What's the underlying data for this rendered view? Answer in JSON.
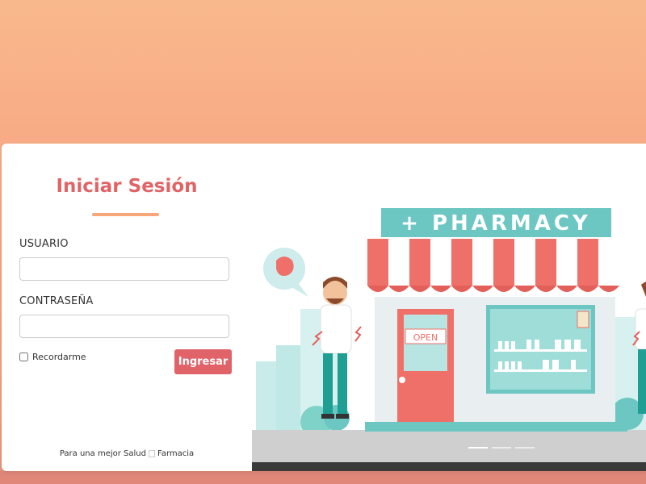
{
  "login": {
    "title": "Iniciar Sesión",
    "username_label": "USUARIO",
    "username_value": "",
    "password_label": "CONTRASEÑA",
    "password_value": "",
    "remember_label": "Recordarme",
    "submit_label": "Ingresar"
  },
  "footer": {
    "text_before": "Para una mejor Salud",
    "text_after": "Farmacia"
  },
  "illustration": {
    "sign_text": "+ PHARMACY",
    "door_sign": "OPEN",
    "carousel": {
      "slides": 3,
      "active": 1
    }
  },
  "colors": {
    "accent": "#e0636a",
    "title": "#e06466",
    "underline": "#f7a779",
    "background_top": "#f9b88c",
    "sign_teal": "#6cc6c2",
    "awning_red": "#ee7068",
    "door": "#ee7068"
  }
}
